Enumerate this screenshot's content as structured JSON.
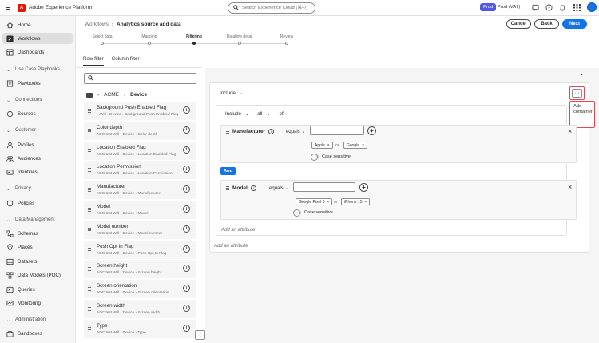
{
  "app": {
    "title": "Adobe Experience Platform",
    "logo_letter": "A"
  },
  "search": {
    "placeholder": "Search Experience Cloud (⌘+/)"
  },
  "org": {
    "badge": "Prod",
    "name": "Prod (VA7)"
  },
  "nav": {
    "items": [
      {
        "label": "Home",
        "icon": "home-icon"
      },
      {
        "label": "Workflows",
        "icon": "workflows-icon",
        "active": true
      },
      {
        "label": "Dashboards",
        "icon": "dashboards-icon"
      }
    ],
    "sections": [
      {
        "label": "Use Case Playbooks",
        "items": [
          {
            "label": "Playbooks",
            "icon": "playbooks-icon"
          }
        ]
      },
      {
        "label": "Connections",
        "items": [
          {
            "label": "Sources",
            "icon": "sources-icon"
          }
        ]
      },
      {
        "label": "Customer",
        "items": [
          {
            "label": "Profiles",
            "icon": "profiles-icon"
          },
          {
            "label": "Audiences",
            "icon": "audiences-icon"
          },
          {
            "label": "Identities",
            "icon": "identities-icon"
          }
        ]
      },
      {
        "label": "Privacy",
        "items": [
          {
            "label": "Policies",
            "icon": "policies-icon"
          }
        ]
      },
      {
        "label": "Data Management",
        "items": [
          {
            "label": "Schemas",
            "icon": "schemas-icon"
          },
          {
            "label": "Places",
            "icon": "places-icon"
          },
          {
            "label": "Datasets",
            "icon": "datasets-icon"
          },
          {
            "label": "Data Models (POC)",
            "icon": "data-models-icon"
          },
          {
            "label": "Queries",
            "icon": "queries-icon"
          },
          {
            "label": "Monitoring",
            "icon": "monitoring-icon"
          }
        ]
      },
      {
        "label": "Administration",
        "items": [
          {
            "label": "Sandboxes",
            "icon": "sandboxes-icon"
          }
        ]
      }
    ]
  },
  "breadcrumb": {
    "parent": "Workflows",
    "separator": "›",
    "current": "Analytics source add data"
  },
  "actions": {
    "cancel": "Cancel",
    "back": "Back",
    "next": "Next"
  },
  "steps": [
    {
      "label": "Select data"
    },
    {
      "label": "Mapping"
    },
    {
      "label": "Filtering",
      "active": true
    },
    {
      "label": "Dataflow detail"
    },
    {
      "label": "Review"
    }
  ],
  "tabs": {
    "row_filter": "Row filter",
    "column_filter": "Column filter"
  },
  "path": {
    "parent": "ACME",
    "current": "Device"
  },
  "attributes": [
    {
      "name": "Background Push Enabled Flag",
      "path": "...Will › Device › Background Push Enabled Flag"
    },
    {
      "name": "Color depth",
      "path": "ADC test Will › Device › Color depth"
    },
    {
      "name": "Location Enabled Flag",
      "path": "ADC test Will › Device › Location Enabled Flag"
    },
    {
      "name": "Location Permission",
      "path": "ADC test Will › Device › Location Permission"
    },
    {
      "name": "Manufacturer",
      "path": "ADC test Will › Device › Manufacturer"
    },
    {
      "name": "Model",
      "path": "ADC test Will › Device › Model"
    },
    {
      "name": "Model number",
      "path": "ADC test Will › Device › Model number"
    },
    {
      "name": "Push Opt In Flag",
      "path": "ADC test Will › Device › Push Opt In Flag"
    },
    {
      "name": "Screen height",
      "path": "ADC test Will › Device › Screen height"
    },
    {
      "name": "Screen orientation",
      "path": "ADC test Will › Device › Screen orientation"
    },
    {
      "name": "Screen width",
      "path": "ADC test Will › Device › Screen width"
    },
    {
      "name": "Type",
      "path": "ADC test Will › Device › Type"
    }
  ],
  "filter": {
    "outer_include": "Include",
    "more_menu": "Add container",
    "inner_include": "Include",
    "inner_quantifier": "all",
    "inner_of": "of:",
    "rules": [
      {
        "name": "Manufacturer",
        "operator": "equals",
        "values": [
          "Apple",
          "Google"
        ],
        "or_label": "or",
        "case_label": "Case sensitive"
      },
      {
        "name": "Model",
        "operator": "equals",
        "values": [
          "Google Pixel 8",
          "iPhone 15"
        ],
        "or_label": "or",
        "case_label": "Case sensitive"
      }
    ],
    "and_label": "And",
    "add_attribute_inner": "Add an attribute",
    "add_attribute_outer": "Add an attribute"
  },
  "colors": {
    "accent": "#1473e6",
    "highlight": "#e34850",
    "prod_badge": "#5258e4",
    "adobe_red": "#eb1000"
  }
}
